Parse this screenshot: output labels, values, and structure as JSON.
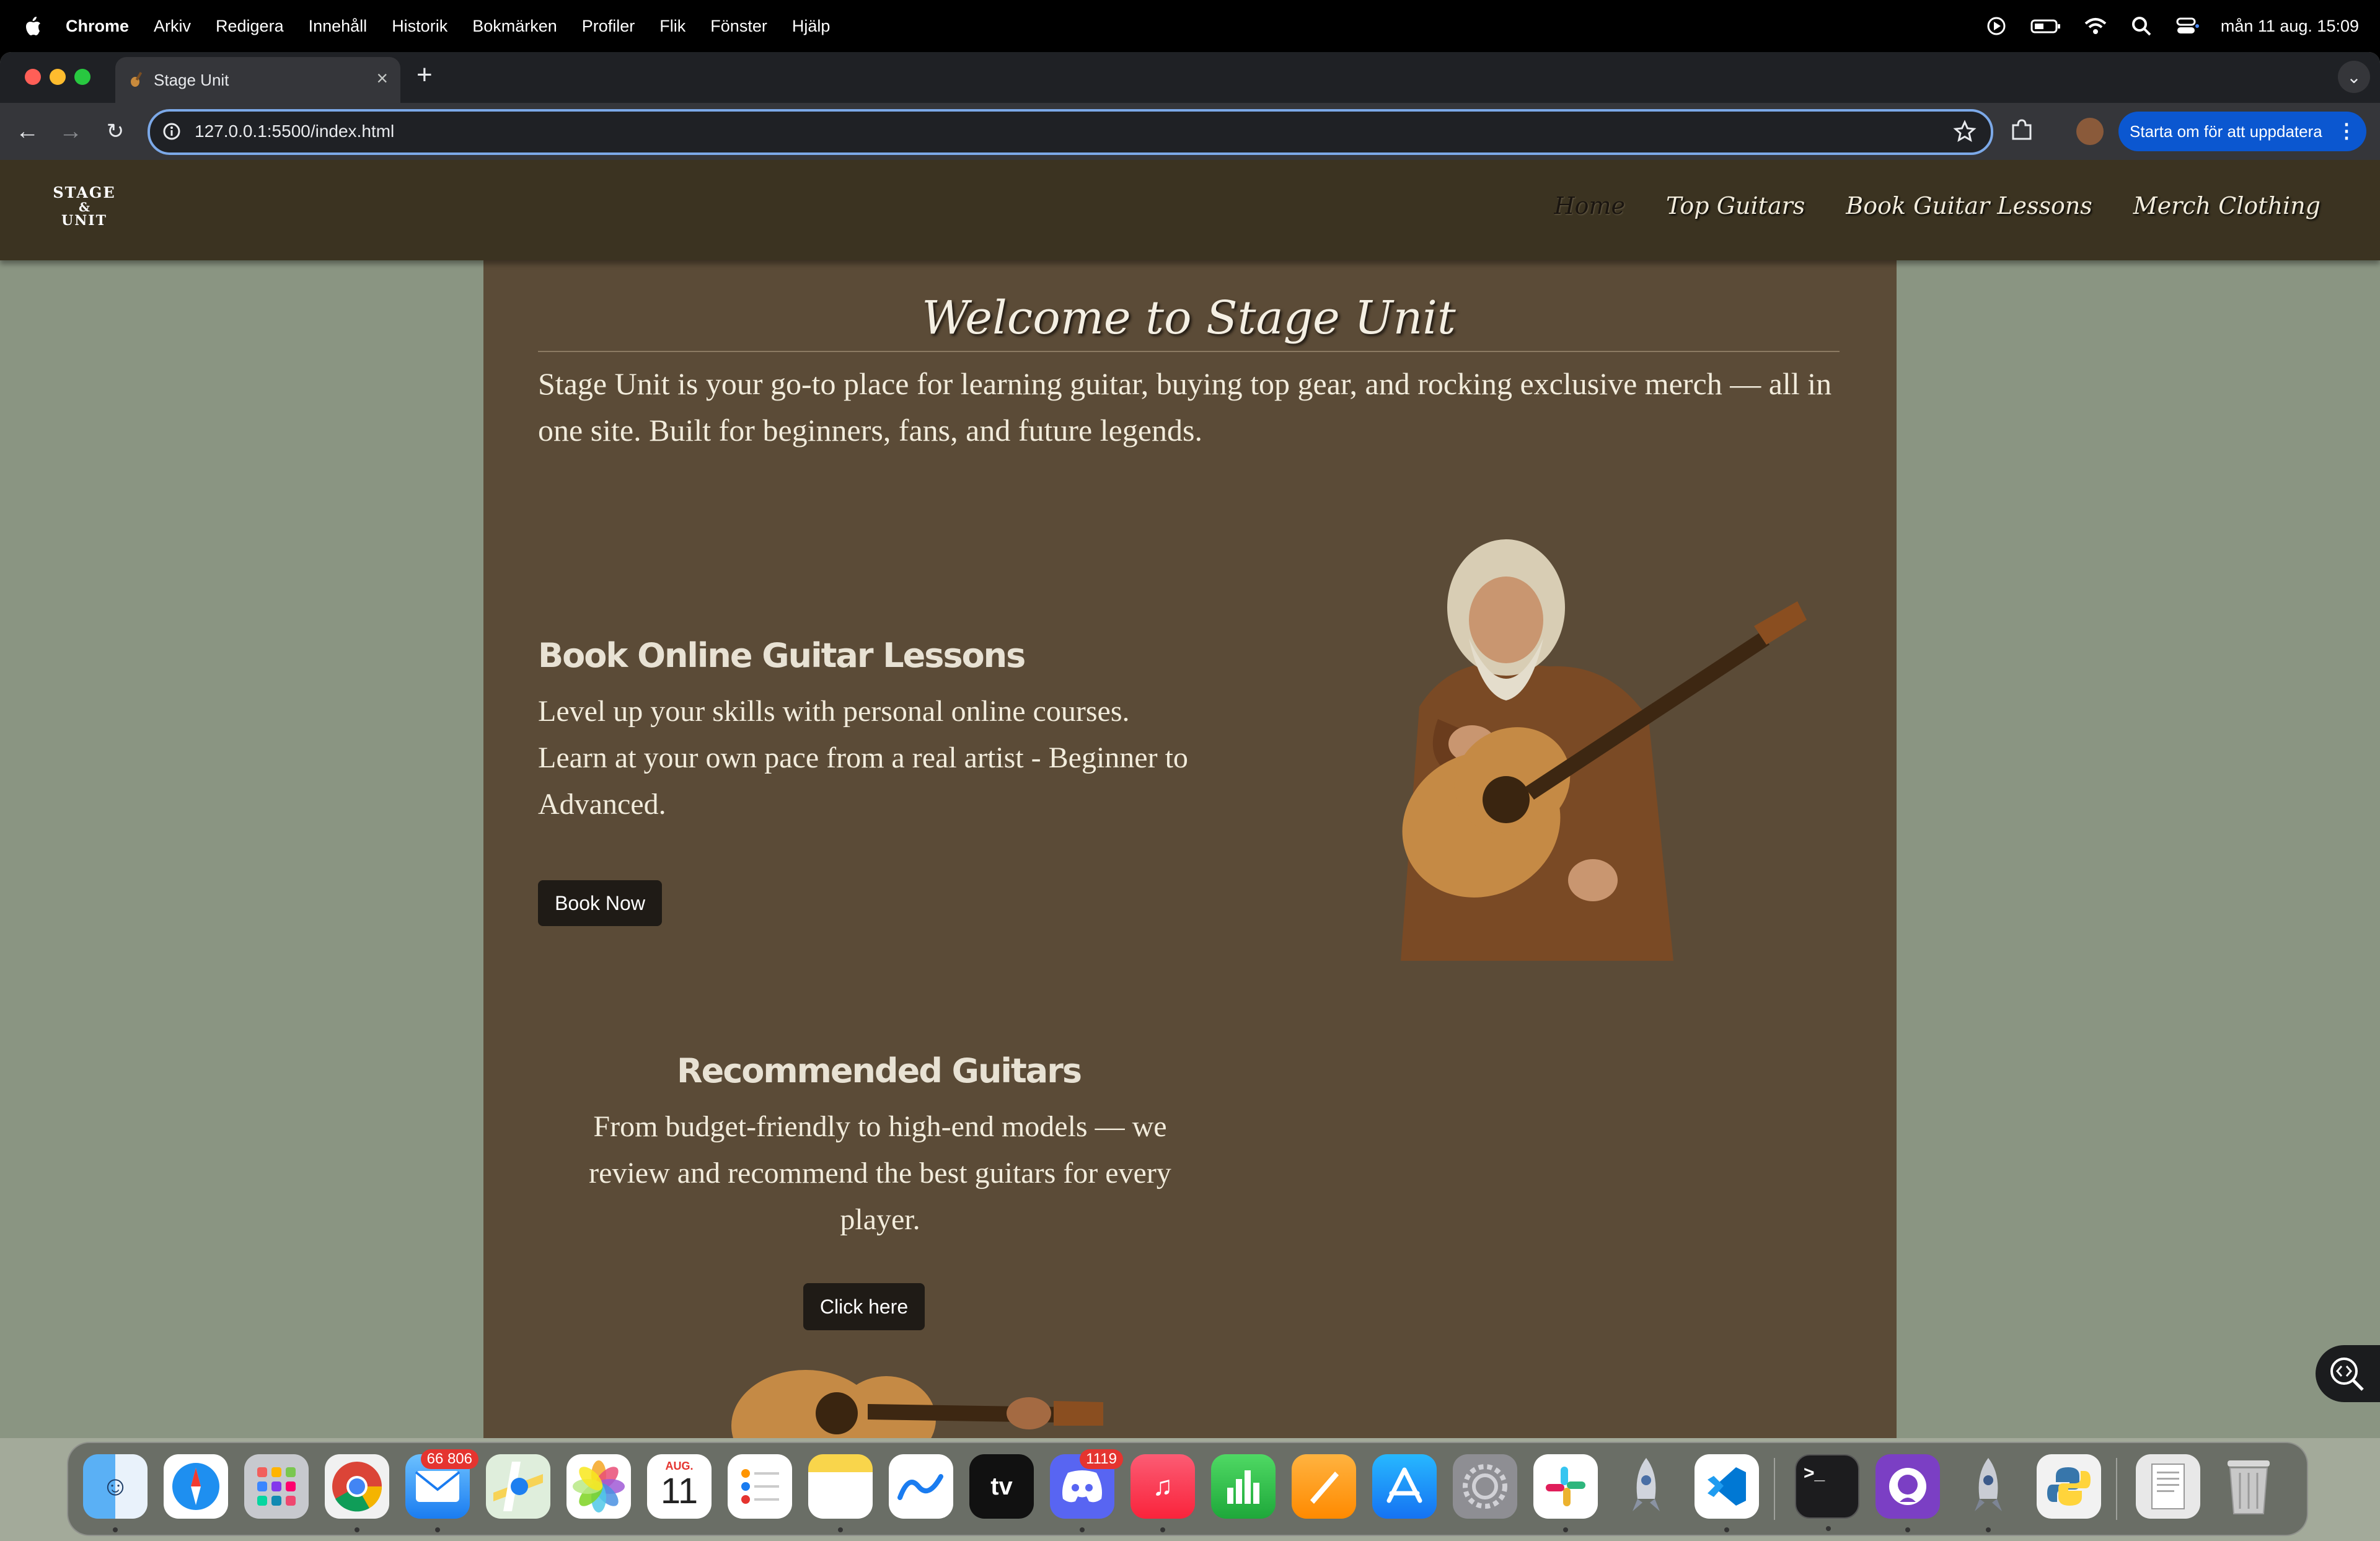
{
  "menubar": {
    "app_name": "Chrome",
    "items": [
      "Arkiv",
      "Redigera",
      "Innehåll",
      "Historik",
      "Bokmärken",
      "Profiler",
      "Flik",
      "Fönster",
      "Hjälp"
    ],
    "clock": "mån 11 aug.  15:09"
  },
  "browser": {
    "tab_title": "Stage Unit",
    "url": "127.0.0.1:5500/index.html",
    "update_label": "Starta om för att uppdatera"
  },
  "site": {
    "logo": {
      "line1": "STAGE",
      "line2": "&",
      "line3": "UNIT"
    },
    "nav": [
      "Home",
      "Top Guitars",
      "Book Guitar Lessons",
      "Merch Clothing"
    ],
    "active_nav": "Home",
    "welcome_title": "Welcome to Stage Unit",
    "intro": "Stage Unit is your go-to place for learning guitar, buying top gear, and rocking exclusive merch — all in one site. Built for beginners, fans, and future legends.",
    "lessons": {
      "title": "Book Online Guitar Lessons",
      "text": "Level up your skills with personal online courses. Learn at your own pace from a real artist - Beginner to Advanced.",
      "button": "Book Now"
    },
    "recommended": {
      "title": "Recommended Guitars",
      "text": "From budget-friendly to high-end models — we review and recommend the best guitars for every player.",
      "button": "Click here"
    }
  },
  "dock": {
    "badges": {
      "mail": "66 806",
      "discord": "1119"
    },
    "calendar": {
      "month": "AUG.",
      "day": "11"
    },
    "apps": [
      "finder",
      "safari",
      "launchpad",
      "chrome",
      "mail",
      "maps",
      "photos",
      "calendar",
      "reminders",
      "notes",
      "freeform",
      "tv",
      "discord",
      "music",
      "numbers",
      "pages",
      "app-store",
      "system-settings",
      "slack",
      "rocket",
      "vscode",
      "terminal",
      "github-desktop",
      "rocket-2",
      "python",
      "preview",
      "trash"
    ]
  },
  "colors": {
    "header_bg": "#3b3321",
    "main_bg": "#5b4b37",
    "side_bg": "#8a9582",
    "button_bg": "#1f1b16",
    "accent_blue": "#0b57d0"
  }
}
